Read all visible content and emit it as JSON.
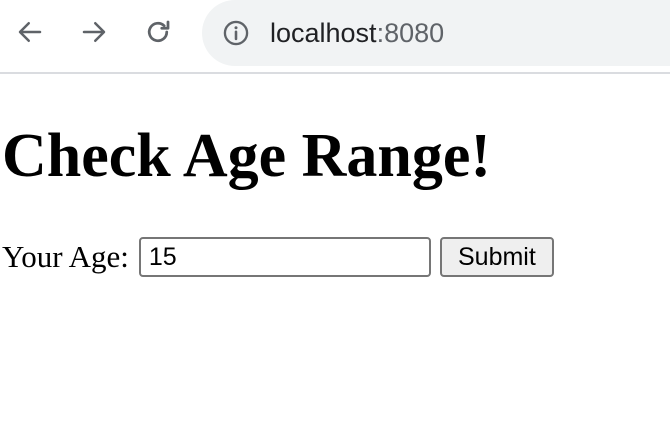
{
  "browser": {
    "icons": {
      "back": "arrow-left-icon",
      "forward": "arrow-right-icon",
      "reload": "reload-icon",
      "site_info": "info-circle-icon"
    },
    "url_host": "localhost",
    "url_port": ":8080"
  },
  "page": {
    "title": "Check Age Range!",
    "form": {
      "age_label": "Your Age:",
      "age_value": "15",
      "submit_label": "Submit"
    }
  },
  "colors": {
    "toolbar_icon": "#5f6368",
    "omnibox_bg": "#f1f3f4",
    "text": "#000000",
    "button_bg": "#efefef",
    "input_border": "#767676"
  }
}
